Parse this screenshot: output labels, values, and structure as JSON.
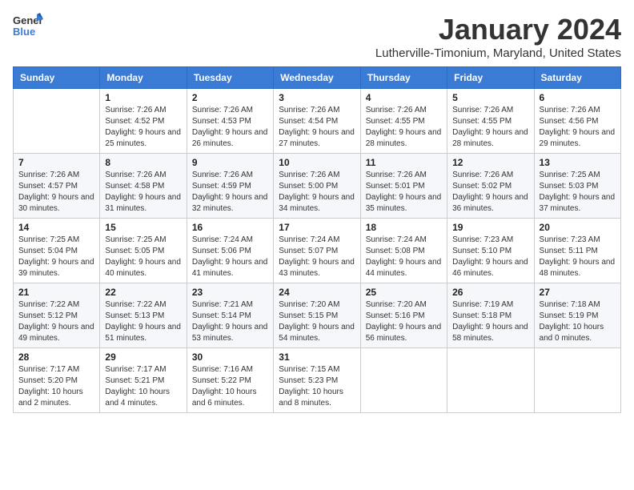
{
  "header": {
    "logo_general": "General",
    "logo_blue": "Blue",
    "month_title": "January 2024",
    "location": "Lutherville-Timonium, Maryland, United States"
  },
  "weekdays": [
    "Sunday",
    "Monday",
    "Tuesday",
    "Wednesday",
    "Thursday",
    "Friday",
    "Saturday"
  ],
  "weeks": [
    [
      {
        "day": "",
        "sunrise": "",
        "sunset": "",
        "daylight": ""
      },
      {
        "day": "1",
        "sunrise": "Sunrise: 7:26 AM",
        "sunset": "Sunset: 4:52 PM",
        "daylight": "Daylight: 9 hours and 25 minutes."
      },
      {
        "day": "2",
        "sunrise": "Sunrise: 7:26 AM",
        "sunset": "Sunset: 4:53 PM",
        "daylight": "Daylight: 9 hours and 26 minutes."
      },
      {
        "day": "3",
        "sunrise": "Sunrise: 7:26 AM",
        "sunset": "Sunset: 4:54 PM",
        "daylight": "Daylight: 9 hours and 27 minutes."
      },
      {
        "day": "4",
        "sunrise": "Sunrise: 7:26 AM",
        "sunset": "Sunset: 4:55 PM",
        "daylight": "Daylight: 9 hours and 28 minutes."
      },
      {
        "day": "5",
        "sunrise": "Sunrise: 7:26 AM",
        "sunset": "Sunset: 4:55 PM",
        "daylight": "Daylight: 9 hours and 28 minutes."
      },
      {
        "day": "6",
        "sunrise": "Sunrise: 7:26 AM",
        "sunset": "Sunset: 4:56 PM",
        "daylight": "Daylight: 9 hours and 29 minutes."
      }
    ],
    [
      {
        "day": "7",
        "sunrise": "Sunrise: 7:26 AM",
        "sunset": "Sunset: 4:57 PM",
        "daylight": "Daylight: 9 hours and 30 minutes."
      },
      {
        "day": "8",
        "sunrise": "Sunrise: 7:26 AM",
        "sunset": "Sunset: 4:58 PM",
        "daylight": "Daylight: 9 hours and 31 minutes."
      },
      {
        "day": "9",
        "sunrise": "Sunrise: 7:26 AM",
        "sunset": "Sunset: 4:59 PM",
        "daylight": "Daylight: 9 hours and 32 minutes."
      },
      {
        "day": "10",
        "sunrise": "Sunrise: 7:26 AM",
        "sunset": "Sunset: 5:00 PM",
        "daylight": "Daylight: 9 hours and 34 minutes."
      },
      {
        "day": "11",
        "sunrise": "Sunrise: 7:26 AM",
        "sunset": "Sunset: 5:01 PM",
        "daylight": "Daylight: 9 hours and 35 minutes."
      },
      {
        "day": "12",
        "sunrise": "Sunrise: 7:26 AM",
        "sunset": "Sunset: 5:02 PM",
        "daylight": "Daylight: 9 hours and 36 minutes."
      },
      {
        "day": "13",
        "sunrise": "Sunrise: 7:25 AM",
        "sunset": "Sunset: 5:03 PM",
        "daylight": "Daylight: 9 hours and 37 minutes."
      }
    ],
    [
      {
        "day": "14",
        "sunrise": "Sunrise: 7:25 AM",
        "sunset": "Sunset: 5:04 PM",
        "daylight": "Daylight: 9 hours and 39 minutes."
      },
      {
        "day": "15",
        "sunrise": "Sunrise: 7:25 AM",
        "sunset": "Sunset: 5:05 PM",
        "daylight": "Daylight: 9 hours and 40 minutes."
      },
      {
        "day": "16",
        "sunrise": "Sunrise: 7:24 AM",
        "sunset": "Sunset: 5:06 PM",
        "daylight": "Daylight: 9 hours and 41 minutes."
      },
      {
        "day": "17",
        "sunrise": "Sunrise: 7:24 AM",
        "sunset": "Sunset: 5:07 PM",
        "daylight": "Daylight: 9 hours and 43 minutes."
      },
      {
        "day": "18",
        "sunrise": "Sunrise: 7:24 AM",
        "sunset": "Sunset: 5:08 PM",
        "daylight": "Daylight: 9 hours and 44 minutes."
      },
      {
        "day": "19",
        "sunrise": "Sunrise: 7:23 AM",
        "sunset": "Sunset: 5:10 PM",
        "daylight": "Daylight: 9 hours and 46 minutes."
      },
      {
        "day": "20",
        "sunrise": "Sunrise: 7:23 AM",
        "sunset": "Sunset: 5:11 PM",
        "daylight": "Daylight: 9 hours and 48 minutes."
      }
    ],
    [
      {
        "day": "21",
        "sunrise": "Sunrise: 7:22 AM",
        "sunset": "Sunset: 5:12 PM",
        "daylight": "Daylight: 9 hours and 49 minutes."
      },
      {
        "day": "22",
        "sunrise": "Sunrise: 7:22 AM",
        "sunset": "Sunset: 5:13 PM",
        "daylight": "Daylight: 9 hours and 51 minutes."
      },
      {
        "day": "23",
        "sunrise": "Sunrise: 7:21 AM",
        "sunset": "Sunset: 5:14 PM",
        "daylight": "Daylight: 9 hours and 53 minutes."
      },
      {
        "day": "24",
        "sunrise": "Sunrise: 7:20 AM",
        "sunset": "Sunset: 5:15 PM",
        "daylight": "Daylight: 9 hours and 54 minutes."
      },
      {
        "day": "25",
        "sunrise": "Sunrise: 7:20 AM",
        "sunset": "Sunset: 5:16 PM",
        "daylight": "Daylight: 9 hours and 56 minutes."
      },
      {
        "day": "26",
        "sunrise": "Sunrise: 7:19 AM",
        "sunset": "Sunset: 5:18 PM",
        "daylight": "Daylight: 9 hours and 58 minutes."
      },
      {
        "day": "27",
        "sunrise": "Sunrise: 7:18 AM",
        "sunset": "Sunset: 5:19 PM",
        "daylight": "Daylight: 10 hours and 0 minutes."
      }
    ],
    [
      {
        "day": "28",
        "sunrise": "Sunrise: 7:17 AM",
        "sunset": "Sunset: 5:20 PM",
        "daylight": "Daylight: 10 hours and 2 minutes."
      },
      {
        "day": "29",
        "sunrise": "Sunrise: 7:17 AM",
        "sunset": "Sunset: 5:21 PM",
        "daylight": "Daylight: 10 hours and 4 minutes."
      },
      {
        "day": "30",
        "sunrise": "Sunrise: 7:16 AM",
        "sunset": "Sunset: 5:22 PM",
        "daylight": "Daylight: 10 hours and 6 minutes."
      },
      {
        "day": "31",
        "sunrise": "Sunrise: 7:15 AM",
        "sunset": "Sunset: 5:23 PM",
        "daylight": "Daylight: 10 hours and 8 minutes."
      },
      {
        "day": "",
        "sunrise": "",
        "sunset": "",
        "daylight": ""
      },
      {
        "day": "",
        "sunrise": "",
        "sunset": "",
        "daylight": ""
      },
      {
        "day": "",
        "sunrise": "",
        "sunset": "",
        "daylight": ""
      }
    ]
  ]
}
